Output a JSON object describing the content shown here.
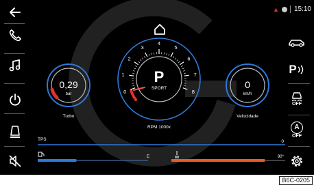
{
  "colors": {
    "accent_blue": "#2f79d8",
    "accent_red": "#e03030",
    "panel": "#000000",
    "text": "#ffffff"
  },
  "left_menu": [
    {
      "name": "back-icon"
    },
    {
      "name": "phone-icon"
    },
    {
      "name": "music-icon"
    },
    {
      "name": "power-icon"
    },
    {
      "name": "alert-bell-icon"
    },
    {
      "name": "mute-icon"
    }
  ],
  "right_menu": {
    "parking_label": "P",
    "traction_off_label": "OFF",
    "auto_label": "A",
    "auto_off_label": "OFF"
  },
  "status": {
    "time": "15:10"
  },
  "gauges": {
    "turbo": {
      "value": "0,29",
      "unit": "bar",
      "label": "Turbo"
    },
    "rpm": {
      "gear": "P",
      "mode": "SPORT",
      "label": "RPM 1000x",
      "scale": [
        "0",
        "1",
        "2",
        "3",
        "4",
        "5",
        "6",
        "7",
        "8"
      ],
      "needle_value": 1
    },
    "speed": {
      "value": "0",
      "unit": "km/h",
      "label": "Velocidade"
    }
  },
  "bars": {
    "tps": {
      "label": "TPS",
      "value": "0",
      "fraction": 0
    },
    "fuel": {
      "empty_mark": "E",
      "fraction": 0.35
    },
    "temp": {
      "value": "90°",
      "fraction": 0.82
    }
  },
  "doc_id": "B6C-0205"
}
